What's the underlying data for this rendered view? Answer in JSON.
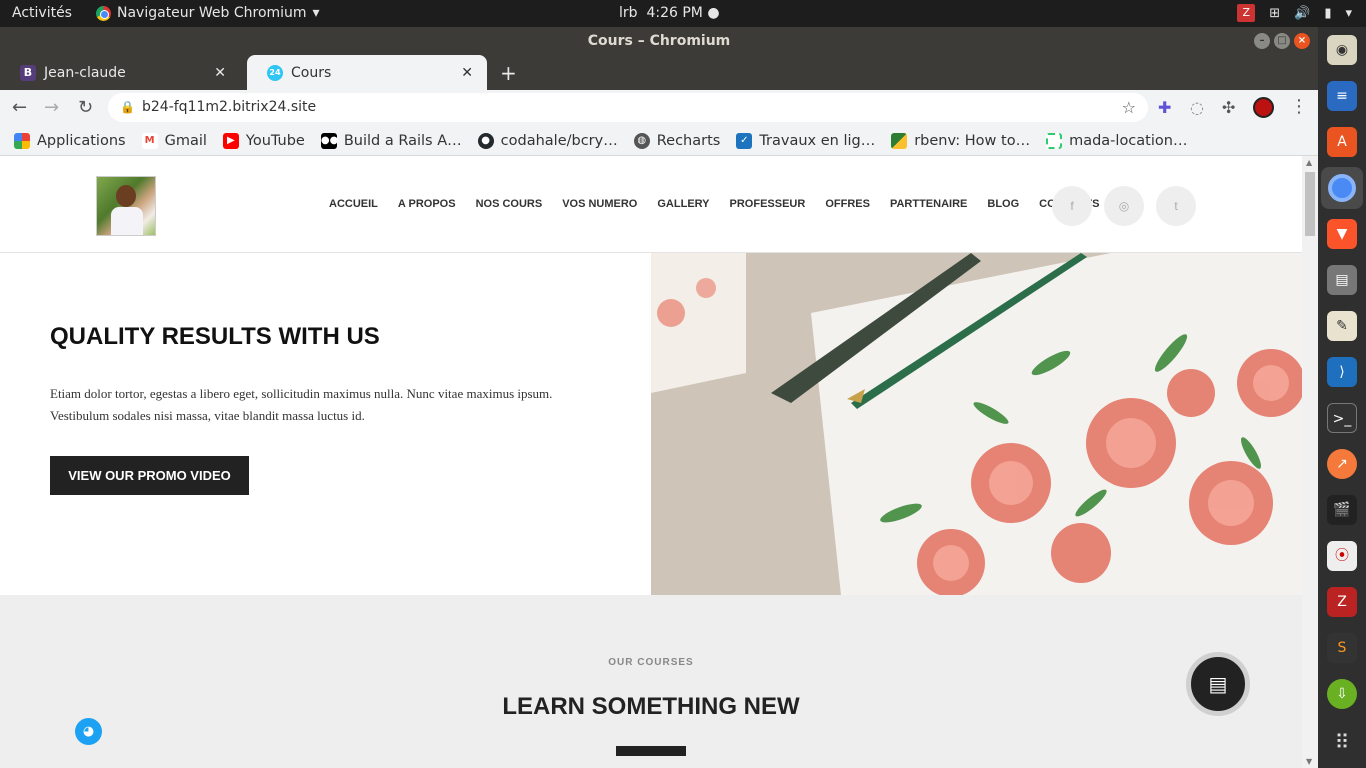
{
  "system": {
    "activities": "Activités",
    "app_name": "Navigateur Web Chromium",
    "user": "lrb",
    "time": "4:26 PM"
  },
  "window": {
    "title": "Cours – Chromium"
  },
  "tabs": [
    {
      "label": "Jean-claude",
      "favicon_letter": "B",
      "favicon_color": "#563d7c"
    },
    {
      "label": "Cours",
      "favicon_letter": "24",
      "favicon_color": "#2fc6f6"
    }
  ],
  "address": {
    "url": "b24-fq11m2.bitrix24.site"
  },
  "bookmarks": [
    {
      "label": "Applications",
      "icon": "apps-grid-icon",
      "color": "#e94235"
    },
    {
      "label": "Gmail",
      "icon": "gmail-icon",
      "color": "#ea4335"
    },
    {
      "label": "YouTube",
      "icon": "youtube-icon",
      "color": "#ff0000"
    },
    {
      "label": "Build a Rails A…",
      "icon": "medium-icon",
      "color": "#000000"
    },
    {
      "label": "codahale/bcry…",
      "icon": "github-icon",
      "color": "#24292e"
    },
    {
      "label": "Recharts",
      "icon": "globe-icon",
      "color": "#555555"
    },
    {
      "label": "Travaux en lig…",
      "icon": "travaux-icon",
      "color": "#1e73be"
    },
    {
      "label": "rbenv: How to…",
      "icon": "rbenv-icon",
      "color": "#222222"
    },
    {
      "label": "mada-location…",
      "icon": "mada-icon",
      "color": "#2ecc71"
    }
  ],
  "site": {
    "nav": [
      "ACCUEIL",
      "A PROPOS",
      "NOS COURS",
      "VOS NUMERO",
      "GALLERY",
      "PROFESSEUR",
      "OFFRES",
      "PARTTENAIRE",
      "BLOG",
      "CONTACTS"
    ],
    "social": [
      {
        "name": "facebook-icon",
        "glyph": "f"
      },
      {
        "name": "instagram-icon",
        "glyph": "◎"
      },
      {
        "name": "twitter-icon",
        "glyph": "t"
      }
    ],
    "hero": {
      "title": "QUALITY RESULTS WITH US",
      "text": "Etiam dolor tortor, egestas a libero eget, sollicitudin maximus nulla. Nunc vitae maximus ipsum. Vestibulum sodales nisi massa, vitae blandit massa luctus id.",
      "button": "VIEW OUR PROMO VIDEO"
    },
    "courses": {
      "kicker": "OUR COURSES",
      "title": "LEARN SOMETHING NEW"
    }
  }
}
